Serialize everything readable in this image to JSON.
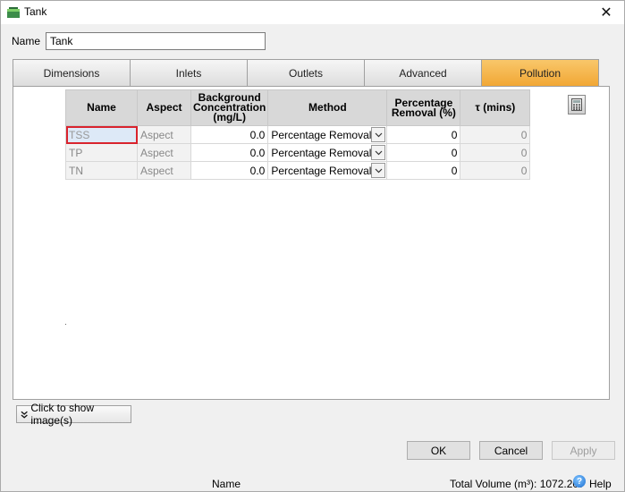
{
  "window": {
    "title": "Tank",
    "close_glyph": "✕",
    "icon": "tank-icon"
  },
  "name_field": {
    "label": "Name",
    "value": "Tank"
  },
  "tabs": [
    {
      "label": "Dimensions",
      "active": false
    },
    {
      "label": "Inlets",
      "active": false
    },
    {
      "label": "Outlets",
      "active": false
    },
    {
      "label": "Advanced",
      "active": false
    },
    {
      "label": "Pollution",
      "active": true
    }
  ],
  "grid": {
    "columns": {
      "name": "Name",
      "aspect": "Aspect",
      "background": "Background Concentration (mg/L)",
      "method": "Method",
      "percentage": "Percentage Removal (%)",
      "tau": "τ (mins)"
    },
    "rows": [
      {
        "name": "TSS",
        "aspect": "Aspect",
        "background": "0.0",
        "method": "Percentage Removal",
        "percentage": "0",
        "tau": "0"
      },
      {
        "name": "TP",
        "aspect": "Aspect",
        "background": "0.0",
        "method": "Percentage Removal",
        "percentage": "0",
        "tau": "0"
      },
      {
        "name": "TN",
        "aspect": "Aspect",
        "background": "0.0",
        "method": "Percentage Removal",
        "percentage": "0",
        "tau": "0"
      }
    ]
  },
  "show_images_label": "Click to show image(s)",
  "buttons": {
    "ok": "OK",
    "cancel": "Cancel",
    "apply": "Apply"
  },
  "status": {
    "name": "Name",
    "total_volume": "Total Volume (m³): 1072.207",
    "help": "Help"
  },
  "colors": {
    "active_tab": "#f1a735",
    "selected_cell_border": "#d9232d"
  }
}
